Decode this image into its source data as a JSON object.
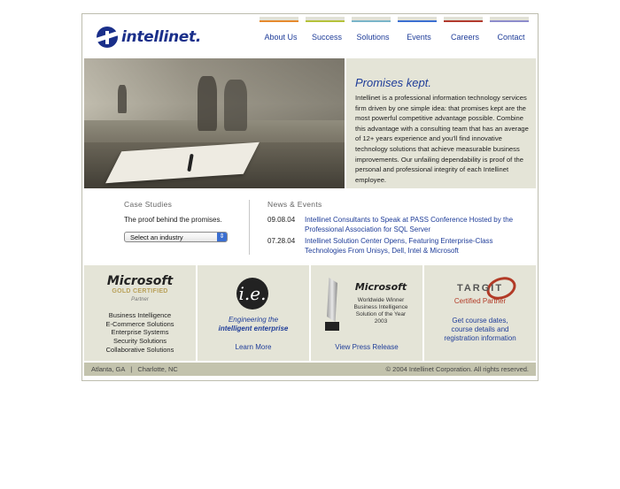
{
  "brand": {
    "logo_text": "intellinet."
  },
  "nav": {
    "items": [
      {
        "label": "About Us",
        "color": "#e68a2e"
      },
      {
        "label": "Success",
        "color": "#b5c23a"
      },
      {
        "label": "Solutions",
        "color": "#7ab5c9"
      },
      {
        "label": "Events",
        "color": "#3b6fd1"
      },
      {
        "label": "Careers",
        "color": "#b23a2e"
      },
      {
        "label": "Contact",
        "color": "#8d8ccc"
      }
    ]
  },
  "hero": {
    "title": "Promises kept.",
    "body": "Intellinet is a professional information technology services firm driven by one simple idea: that promises kept are the most powerful competitive advantage possible. Combine this advantage with a consulting team that has an average of 12+ years experience and you'll find innovative technology solutions that achieve measurable business improvements. Our unfailing dependability is proof of the personal and professional integrity of each Intellinet employee."
  },
  "case_studies": {
    "title": "Case Studies",
    "subtitle": "The proof behind the promises.",
    "select_value": "Select an industry"
  },
  "news": {
    "title": "News & Events",
    "items": [
      {
        "date": "09.08.04",
        "text": "Intellinet Consultants to Speak at PASS Conference Hosted by the Professional Association for SQL Server"
      },
      {
        "date": "07.28.04",
        "text": "Intellinet Solution Center Opens, Featuring Enterprise-Class Technologies From Unisys, Dell, Intel & Microsoft"
      }
    ]
  },
  "tiles": {
    "microsoft": {
      "logo": "Microsoft",
      "badge": "GOLD CERTIFIED",
      "partner": "Partner",
      "services": [
        "Business Intelligence",
        "E-Commerce Solutions",
        "Enterprise Systems",
        "Security Solutions",
        "Collaborative Solutions"
      ]
    },
    "ie": {
      "logo": "i.e.",
      "tagline_1": "Engineering the",
      "tagline_2": "intelligent enterprise",
      "link": "Learn More"
    },
    "award": {
      "logo": "Microsoft",
      "line_1": "Worldwide Winner",
      "line_2": "Business Intelligence",
      "line_3": "Solution of the Year",
      "line_4": "2003",
      "link": "View Press Release"
    },
    "targit": {
      "logo": "TARGIT",
      "badge": "Certified Partner",
      "link_1": "Get course dates,",
      "link_2": "course details and",
      "link_3": "registration information"
    }
  },
  "footer": {
    "locations": "Atlanta, GA   |   Charlotte, NC",
    "copyright": "© 2004 Intellinet Corporation. All rights reserved."
  }
}
